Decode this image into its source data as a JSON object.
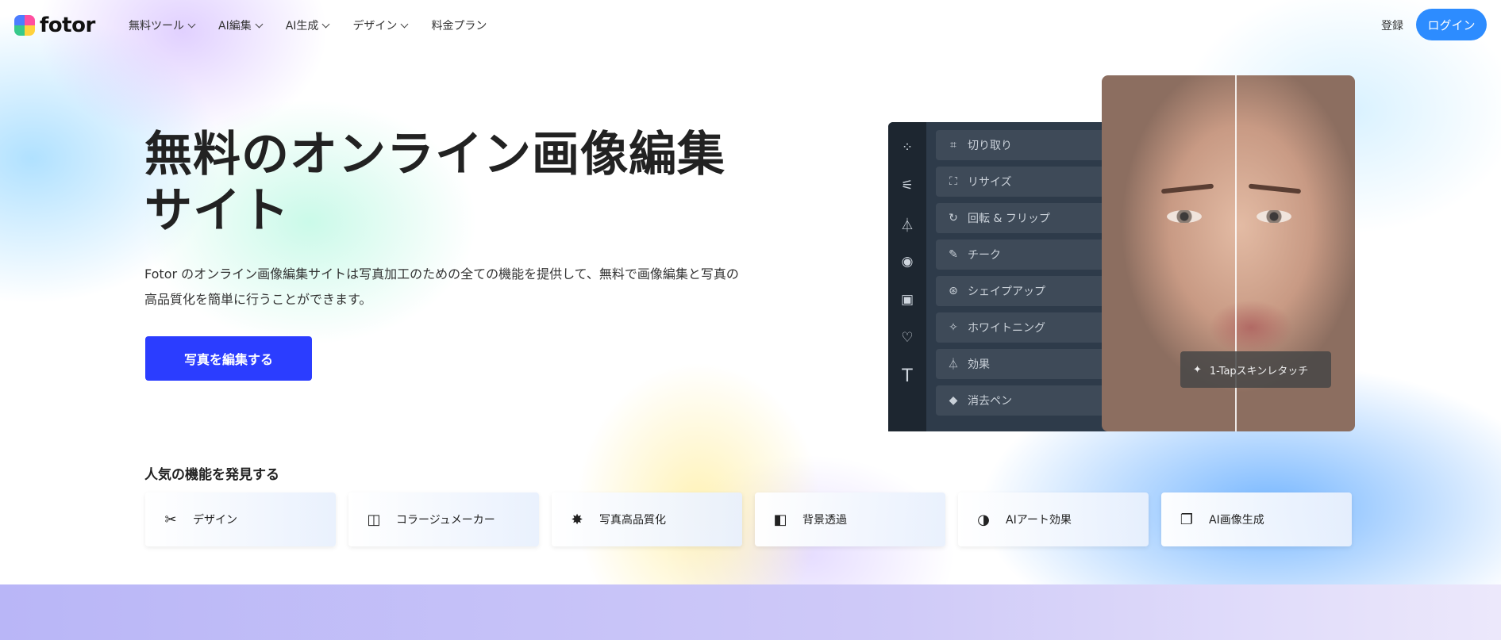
{
  "header": {
    "logo_text": "fotor",
    "nav": [
      {
        "label": "無料ツール",
        "has_dropdown": true
      },
      {
        "label": "AI編集",
        "has_dropdown": true
      },
      {
        "label": "AI生成",
        "has_dropdown": true
      },
      {
        "label": "デザイン",
        "has_dropdown": true
      },
      {
        "label": "料金プラン",
        "has_dropdown": false
      }
    ],
    "register_label": "登録",
    "login_label": "ログイン"
  },
  "hero": {
    "title_line1": "無料のオンライン画像編集",
    "title_line2": "サイト",
    "description": "Fotor のオンライン画像編集サイトは写真加工のための全ての機能を提供して、無料で画像編集と写真の高品質化を簡単に行うことができます。",
    "cta_label": "写真を編集する"
  },
  "editor": {
    "rail_icons": [
      "apps-icon",
      "sliders-icon",
      "flask-icon",
      "eye-icon",
      "frame-icon",
      "elements-icon",
      "text-icon"
    ],
    "menu": [
      {
        "label": "切り取り",
        "icon": "crop-icon"
      },
      {
        "label": "リサイズ",
        "icon": "resize-icon"
      },
      {
        "label": "回転 & フリップ",
        "icon": "rotate-icon"
      },
      {
        "label": "チーク",
        "icon": "blush-icon"
      },
      {
        "label": "シェイプアップ",
        "icon": "reshape-icon"
      },
      {
        "label": "ホワイトニング",
        "icon": "whitening-icon"
      },
      {
        "label": "効果",
        "icon": "effects-icon"
      },
      {
        "label": "消去ペン",
        "icon": "eraser-icon"
      }
    ],
    "tap_label": "1-Tapスキンレタッチ"
  },
  "features": {
    "title": "人気の機能を発見する",
    "cards": [
      {
        "label": "デザイン",
        "icon": "design-tools-icon"
      },
      {
        "label": "コラージュメーカー",
        "icon": "collage-icon"
      },
      {
        "label": "写真高品質化",
        "icon": "enhance-icon"
      },
      {
        "label": "背景透過",
        "icon": "background-remover-icon"
      },
      {
        "label": "AIアート効果",
        "icon": "ai-art-icon"
      },
      {
        "label": "AI画像生成",
        "icon": "ai-image-icon"
      }
    ]
  },
  "colors": {
    "login_button": "#2d8cff",
    "cta_button": "#2b3dff",
    "editor_panel": "#2e3b4a"
  }
}
